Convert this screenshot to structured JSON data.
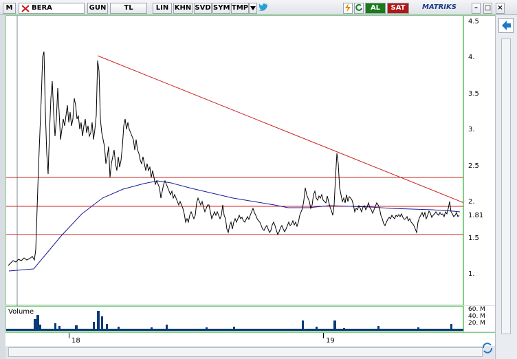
{
  "toolbar": {
    "menu_label": "M",
    "symbol": "BERA",
    "buttons": [
      "GUN",
      "TL",
      "LIN",
      "KHN",
      "SVD",
      "SYM",
      "TMP"
    ],
    "al_label": "AL",
    "sat_label": "SAT",
    "brand": "MATRIKS"
  },
  "price_axis": {
    "ticks": [
      "4.5",
      "4.",
      "3.5",
      "3.",
      "2.5",
      "2.",
      "1.5",
      "1."
    ],
    "last_price": "1.81"
  },
  "volume": {
    "label": "Volume",
    "ticks": [
      "60. M",
      "40. M",
      "20. M"
    ]
  },
  "time_axis": {
    "ticks": [
      "18",
      "19"
    ]
  },
  "colors": {
    "price_line": "#000000",
    "moving_average": "#1a1a9e",
    "trend_lines": "#cc2222",
    "volume_bars": "#0a3a7a",
    "al_button": "#1a7a1a",
    "sat_button": "#b01818"
  },
  "icons": [
    "chart-cross-icon",
    "dropdown-arrow-icon",
    "twitter-bird-icon",
    "lightning-icon",
    "refresh-icon",
    "left-arrow-icon",
    "sync-icon"
  ]
}
